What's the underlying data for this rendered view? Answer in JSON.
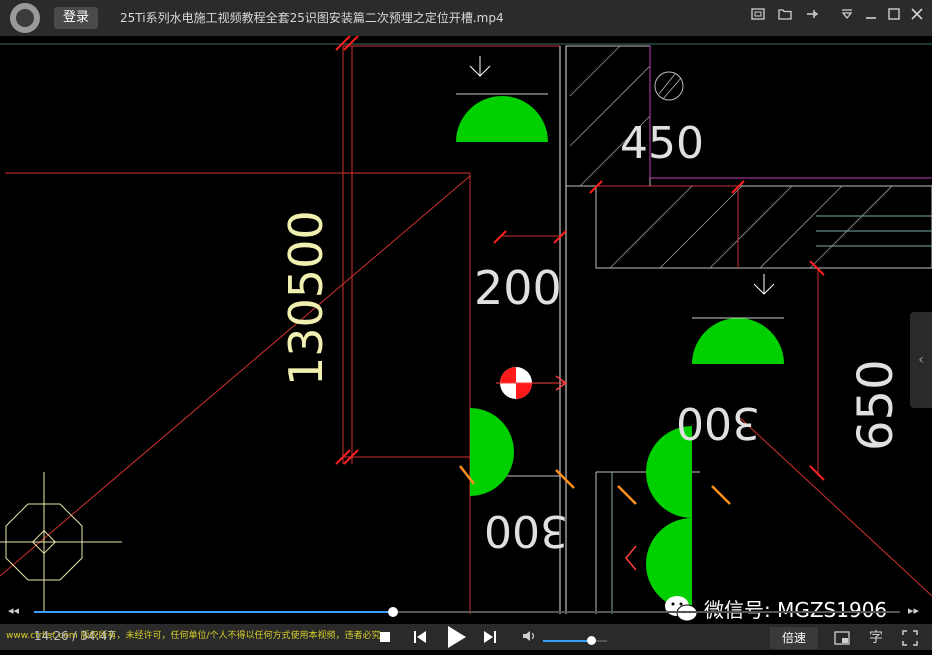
{
  "titlebar": {
    "login_label": "登录",
    "title": "25Ti系列水电施工视频教程全套25识图安装篇二次预埋之定位开槽.mp4",
    "icons": [
      "screenshot-icon",
      "folder-icon",
      "pin-icon",
      "menu-icon",
      "minimize-icon",
      "maximize-icon",
      "close-icon"
    ]
  },
  "drawing": {
    "dims": [
      "450",
      "200",
      "130500",
      "650",
      "300",
      "300"
    ]
  },
  "watermark": {
    "text": "微信号: MGZS1906"
  },
  "controls": {
    "time_current": "14:26",
    "time_total": "34:47",
    "time_sep": " / ",
    "progress_fraction": 0.415,
    "volume_fraction": 0.75,
    "speed_label": "倍速",
    "subtitle_label": "字",
    "scroll_text": "www.ctrlist.com 版权所有，未经许可，任何单位/个人不得以任何方式使用本视频，违者必究"
  }
}
